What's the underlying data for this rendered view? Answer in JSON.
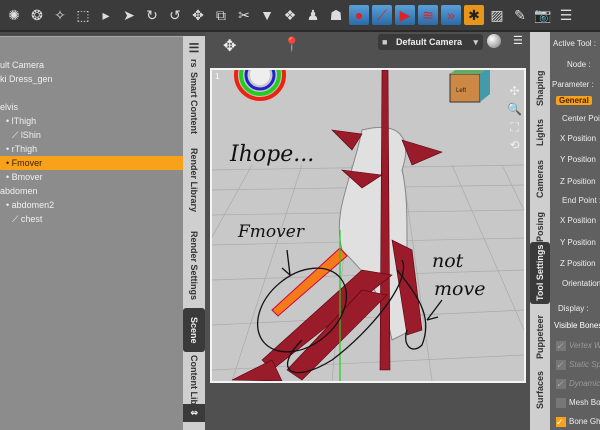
{
  "toolbar": {
    "icons": [
      "render-icon",
      "new-figure-icon",
      "new-light-icon",
      "add-prop-icon",
      "more-icon",
      "select-icon",
      "rotate-universal-icon",
      "rotate-icon",
      "translate-icon",
      "scale-icon",
      "joint-editor-icon",
      "geometry-icon",
      "morph-icon",
      "figure-icon",
      "render-settings-icon",
      "render-red-icon",
      "lines-icon",
      "arrow-icon",
      "zigzag-icon",
      "chevron-icon",
      "joint-editor-active-icon",
      "hatch-icon",
      "edit-icon",
      "camera-icon",
      "list-icon"
    ]
  },
  "scene": {
    "items": [
      {
        "label": "ult Camera",
        "indent": 0
      },
      {
        "label": "ki Dress_gen",
        "indent": 0
      },
      {
        "label": "",
        "indent": 0
      },
      {
        "label": "elvis",
        "indent": 0
      },
      {
        "label": "lThigh",
        "indent": 1
      },
      {
        "label": "lShin",
        "indent": 2
      },
      {
        "label": "rThigh",
        "indent": 1
      },
      {
        "label": "Fmover",
        "indent": 1,
        "selected": true
      },
      {
        "label": "Bmover",
        "indent": 1
      },
      {
        "label": "abdomen",
        "indent": 0
      },
      {
        "label": "abdomen2",
        "indent": 1
      },
      {
        "label": "chest",
        "indent": 2
      }
    ]
  },
  "left_tabs": [
    "Smart Content",
    "Render Library",
    "Render Settings",
    "Scene",
    "Content Library"
  ],
  "left_tab_partial": "rs",
  "left_tab_active": "Scene",
  "viewport": {
    "camera": "Default Camera",
    "corner_label": "1",
    "cube_label": "Left",
    "annotations": [
      "Ihope...",
      "Fmover",
      "not",
      "move"
    ]
  },
  "right_tabs": [
    "Shaping",
    "Lights",
    "Cameras",
    "Posing",
    "Tool Settings",
    "Puppeteer",
    "Surfaces"
  ],
  "right_tab_active": "Tool Settings",
  "tool_settings": {
    "active_tool": "Active Tool :",
    "node": "Node :",
    "parameter": "Parameter :",
    "general": "General",
    "center_point": "Center Point",
    "x_position": "X Position",
    "y_position": "Y Position",
    "z_position": "Z Position",
    "end_point": "End Point :",
    "x_position2": "X Position",
    "y_position2": "Y Position",
    "z_position2": "Z Position",
    "orientation": "Orientation",
    "display": "Display :",
    "visible_bones": "Visible Bones",
    "checks": [
      {
        "label": "Vertex W",
        "checked": true,
        "disabled": true
      },
      {
        "label": "Static Sp",
        "checked": true,
        "disabled": true
      },
      {
        "label": "Dynamic",
        "checked": true,
        "disabled": true
      },
      {
        "label": "Mesh Bo",
        "checked": false,
        "disabled": false
      },
      {
        "label": "Bone Gh",
        "checked": true,
        "disabled": false
      }
    ]
  },
  "colors": {
    "selection": "#f7a21a",
    "panel": "#8c8c8c"
  }
}
